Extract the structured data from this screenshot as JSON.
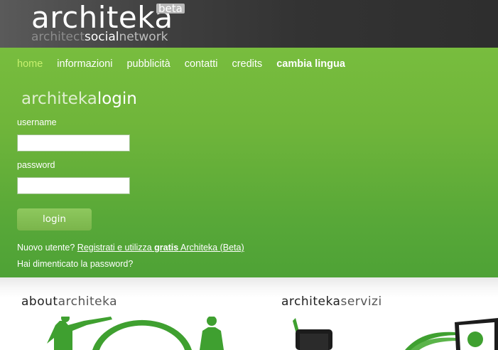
{
  "header": {
    "logo_main": "architeka",
    "logo_beta": "beta",
    "logo_tag": [
      "architect",
      "social",
      "network"
    ]
  },
  "nav": {
    "items": [
      {
        "label": "home",
        "active": true
      },
      {
        "label": "informazioni"
      },
      {
        "label": "pubblicità"
      },
      {
        "label": "contatti"
      },
      {
        "label": "credits"
      },
      {
        "label": "cambia lingua",
        "bold": true
      }
    ]
  },
  "login": {
    "title_a": "architeka",
    "title_b": "login",
    "username_label": "username",
    "username_value": "",
    "password_label": "password",
    "password_value": "",
    "button_label": "login",
    "new_user_prefix": "Nuovo utente?",
    "register_link_a": "Registrati e utilizza ",
    "register_link_bold": "gratis",
    "register_link_b": " Architeka (Beta)",
    "forgot_password": "Hai dimenticato la password?"
  },
  "sections": {
    "about": {
      "title_a": "about",
      "title_b": "architeka"
    },
    "services": {
      "title_a": "architeka",
      "title_b": "servizi"
    }
  },
  "colors": {
    "header_bg": "#333333",
    "green": "#6fb53a",
    "nav_active": "#c7f06e",
    "accent_green": "#3fa030"
  }
}
